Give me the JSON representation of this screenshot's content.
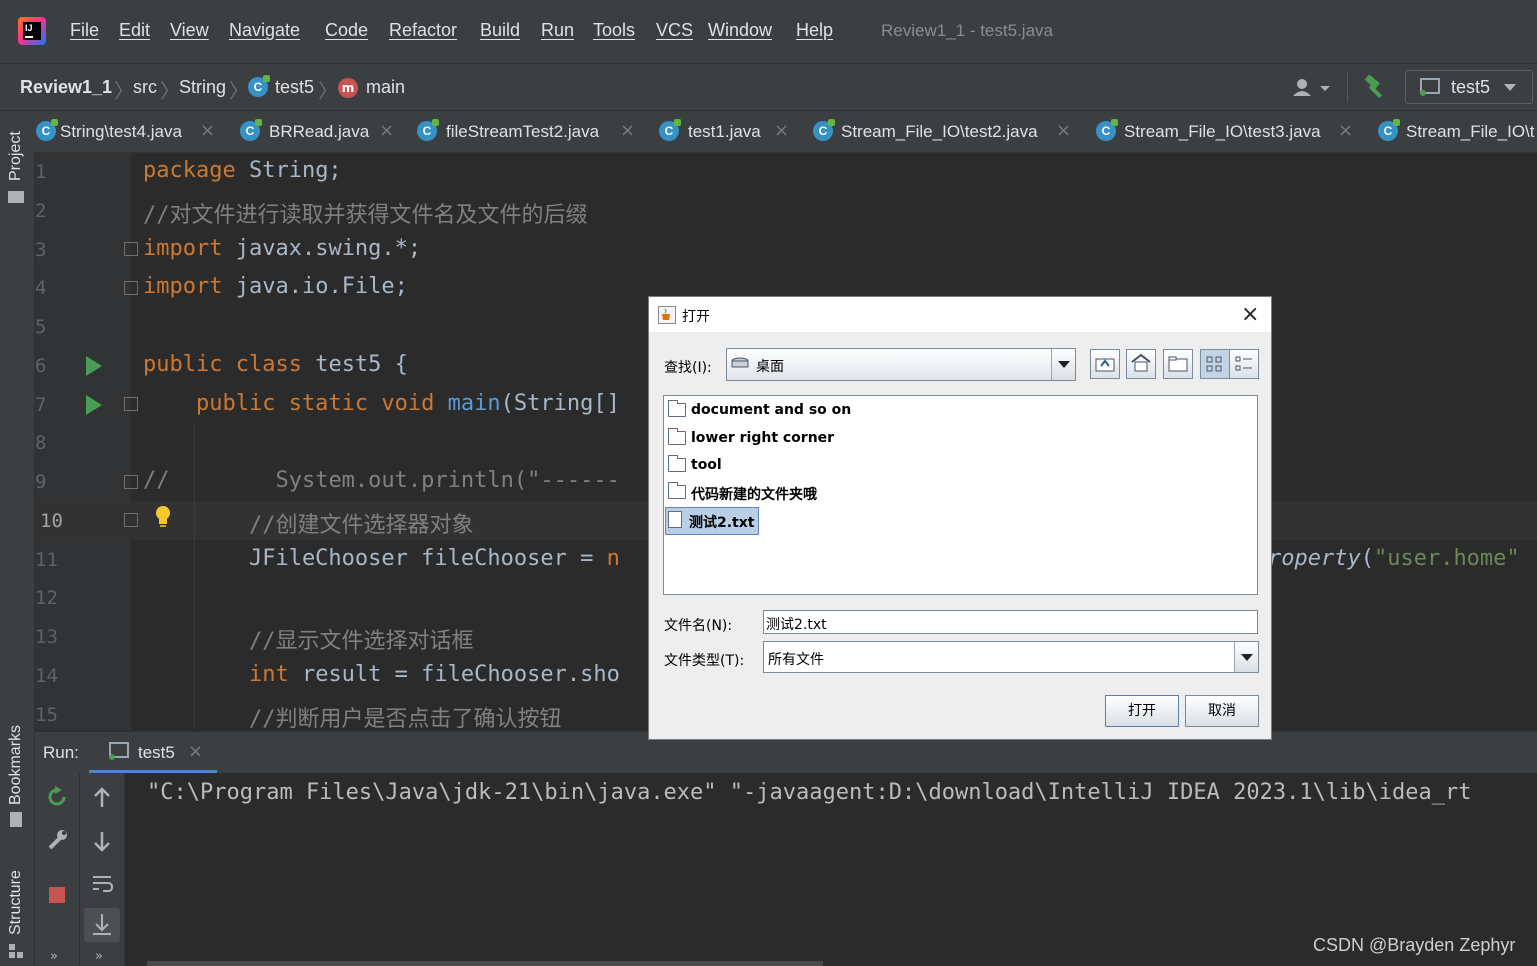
{
  "menubar": {
    "items": [
      "File",
      "Edit",
      "View",
      "Navigate",
      "Code",
      "Refactor",
      "Build",
      "Run",
      "Tools",
      "VCS",
      "Window",
      "Help"
    ],
    "window_title": "Review1_1 - test5.java"
  },
  "navbar": {
    "project": "Review1_1",
    "src": "src",
    "package": "String",
    "class": "test5",
    "method": "main",
    "run_config": "test5"
  },
  "tabs": [
    {
      "label": "String\\test4.java"
    },
    {
      "label": "BRRead.java"
    },
    {
      "label": "fileStreamTest2.java"
    },
    {
      "label": "test1.java"
    },
    {
      "label": "Stream_File_IO\\test2.java"
    },
    {
      "label": "Stream_File_IO\\test3.java"
    },
    {
      "label": "Stream_File_IO\\t"
    }
  ],
  "left_stripe": {
    "project": "Project",
    "bookmarks": "Bookmarks",
    "structure": "Structure"
  },
  "editor": {
    "line_numbers": [
      "1",
      "2",
      "3",
      "4",
      "5",
      "6",
      "7",
      "8",
      "9",
      "10",
      "11",
      "12",
      "13",
      "14",
      "15"
    ],
    "lines": {
      "l1_kw": "package",
      "l1_rest": " String;",
      "l2": "//对文件进行读取并获得文件名及文件的后缀",
      "l3_kw": "import",
      "l3_rest": " javax.swing.*;",
      "l4_kw": "import",
      "l4_rest": " java.io.File;",
      "l6_kw": "public class",
      "l6_rest": " test5 {",
      "l7_kw": "    public static void",
      "l7_fn": " main",
      "l7_rest": "(String[]",
      "l9_cm": "//",
      "l9_rest": "        System.out.println(\"------",
      "l10": "        //创建文件选择器对象",
      "l11_a": "        JFileChooser fileChooser = ",
      "l11_kw": "n",
      "l11_b": "roperty",
      "l11_c": "(",
      "l11_str": "\"user.home\"",
      "l13": "        //显示文件选择对话框",
      "l14_kw": "        int",
      "l14_rest": " result = fileChooser.sho",
      "l15": "        //判断用户是否点击了确认按钮"
    }
  },
  "run_panel": {
    "run_label": "Run:",
    "tab_label": "test5",
    "console_line": "\"C:\\Program Files\\Java\\jdk-21\\bin\\java.exe\" \"-javaagent:D:\\download\\IntelliJ IDEA 2023.1\\lib\\idea_rt",
    "more1": "»",
    "more2": "»"
  },
  "dialog": {
    "title": "打开",
    "look_in_label": "查找(I):",
    "look_in_value": "桌面",
    "files": [
      {
        "name": "document and so on",
        "type": "folder"
      },
      {
        "name": "lower right corner",
        "type": "folder"
      },
      {
        "name": "tool",
        "type": "folder"
      },
      {
        "name": "代码新建的文件夹哦",
        "type": "folder"
      },
      {
        "name": "测试2.txt",
        "type": "file",
        "selected": true
      }
    ],
    "filename_label": "文件名(N):",
    "filename_value": "测试2.txt",
    "filetype_label": "文件类型(T):",
    "filetype_value": "所有文件",
    "open_button": "打开",
    "cancel_button": "取消"
  },
  "watermark": "CSDN @Brayden Zephyr",
  "colors": {
    "keyword": "#cc7832",
    "comment": "#808080",
    "function": "#ffc66d",
    "string": "#6a8759",
    "ide_bg": "#2b2b2b",
    "panel_bg": "#3c3f41",
    "run_green": "#499c54"
  }
}
